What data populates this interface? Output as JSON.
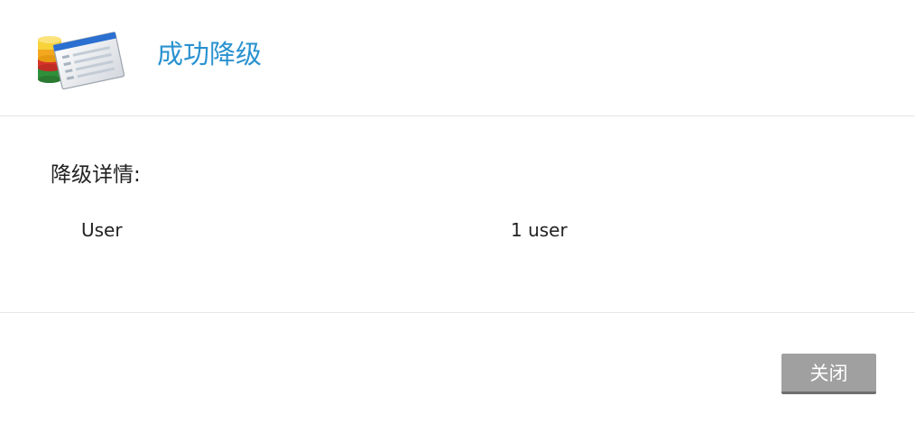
{
  "dialog": {
    "title": "成功降级",
    "icon": "database-list-icon",
    "accent_color": "#2a92d0"
  },
  "details": {
    "heading": "降级详情:",
    "rows": [
      {
        "label": "User",
        "value": "1 user"
      }
    ]
  },
  "footer": {
    "close_label": "关闭",
    "button_color": "#a0a0a0"
  }
}
